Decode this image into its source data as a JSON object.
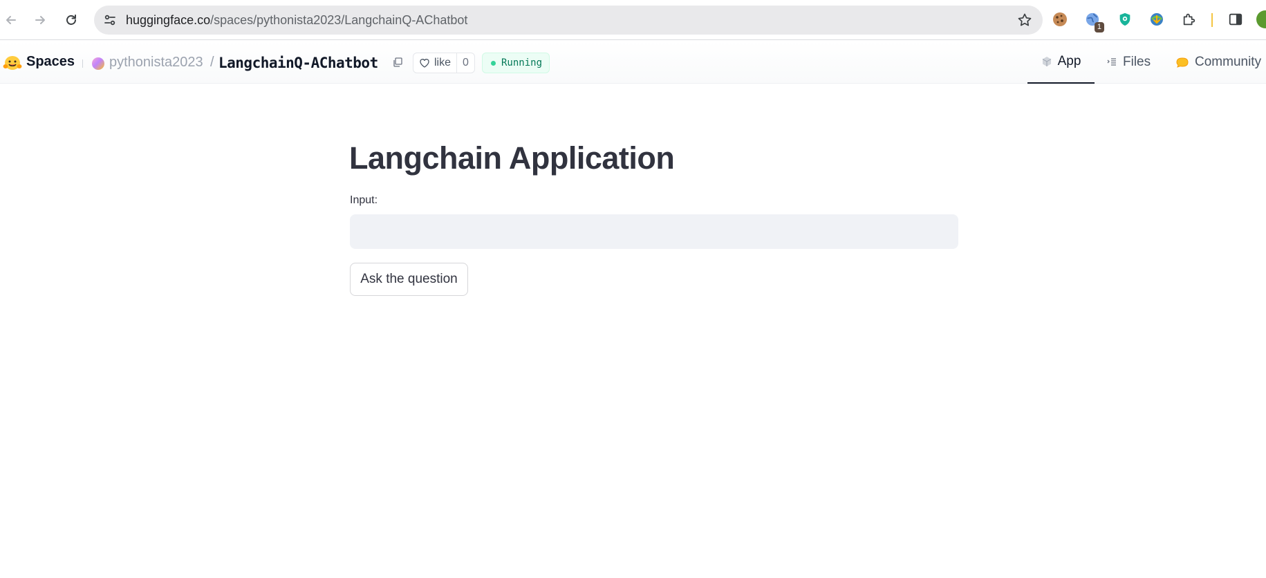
{
  "browser": {
    "url_domain": "huggingface.co",
    "url_path": "/spaces/pythonista2023/LangchainQ-AChatbot",
    "extensions": [
      {
        "icon": "cookie-icon"
      },
      {
        "icon": "globe-icon",
        "badge": "1"
      },
      {
        "icon": "shield-icon"
      },
      {
        "icon": "download-manager-icon"
      },
      {
        "icon": "puzzle-icon"
      }
    ]
  },
  "header": {
    "brand": "Spaces",
    "owner": "pythonista2023",
    "separator": "/",
    "repo": "LangchainQ-AChatbot",
    "like_label": "like",
    "like_count": "0",
    "status": "Running",
    "tabs": [
      {
        "label": "App",
        "icon": "cube-icon",
        "active": true
      },
      {
        "label": "Files",
        "icon": "files-icon",
        "active": false
      },
      {
        "label": "Community",
        "icon": "community-icon",
        "active": false
      }
    ]
  },
  "app": {
    "title": "Langchain Application",
    "input_label": "Input:",
    "input_value": "",
    "button_label": "Ask the question"
  },
  "colors": {
    "accent_running": "#34d399",
    "input_bg": "#f0f2f6",
    "text": "#31333f"
  }
}
